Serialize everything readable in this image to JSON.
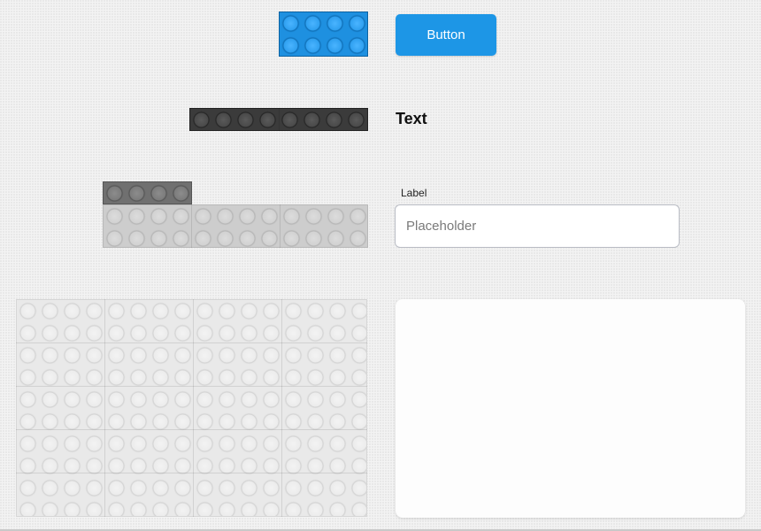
{
  "button": {
    "label": "Button",
    "color": "#1d96e6"
  },
  "text_element": {
    "label": "Text"
  },
  "form_field": {
    "label": "Label",
    "placeholder": "Placeholder",
    "value": ""
  },
  "card": {
    "content": ""
  },
  "bricks": {
    "blue_color": "#1e90e0",
    "dark_color": "#3b3b3b",
    "grey_color": "#707070",
    "light_color": "#cdcdcd",
    "white_color": "#e9e9e9"
  }
}
